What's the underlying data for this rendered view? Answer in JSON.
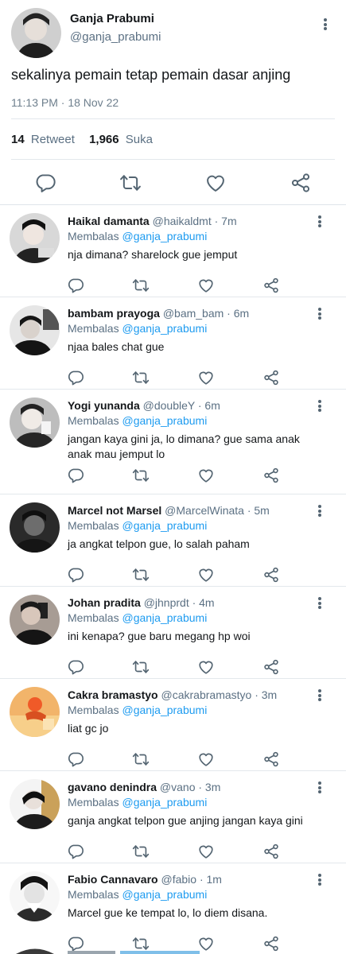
{
  "main_tweet": {
    "author_name": "Ganja Prabumi",
    "author_handle": "@ganja_prabumi",
    "text": "sekalinya pemain tetap pemain dasar anjing",
    "timestamp": "11:13 PM · 18 Nov 22",
    "retweets_count": "14",
    "retweets_label": "Retweet",
    "likes_count": "1,966",
    "likes_label": "Suka"
  },
  "replying_label": "Membalas",
  "replying_mention": "@ganja_prabumi",
  "replies": [
    {
      "name": "Haikal damanta",
      "meta": "@haikaldmt · 7m",
      "text": "nja dimana? sharelock gue jemput"
    },
    {
      "name": "bambam prayoga",
      "meta": "@bam_bam · 6m",
      "text": "njaa bales chat gue"
    },
    {
      "name": "Yogi yunanda",
      "meta": "@doubleY · 6m",
      "text": "jangan kaya gini ja, lo dimana? gue sama anak anak mau jemput lo"
    },
    {
      "name": "Marcel not Marsel",
      "meta": "@MarcelWinata · 5m",
      "text": "ja angkat telpon gue, lo salah paham"
    },
    {
      "name": "Johan pradita",
      "meta": "@jhnprdt · 4m",
      "text": "ini kenapa? gue baru megang hp woi"
    },
    {
      "name": "Cakra bramastyo",
      "meta": "@cakrabramastyo · 3m",
      "text": "liat gc jo"
    },
    {
      "name": "gavano denindra",
      "meta": "@vano · 3m",
      "text": "ganja angkat telpon gue anjing jangan kaya gini"
    },
    {
      "name": "Fabio Cannavaro",
      "meta": "@fabio · 1m",
      "text": "Marcel gue ke tempat lo, lo diem disana."
    }
  ],
  "icons": [
    "reply-icon",
    "retweet-icon",
    "like-icon",
    "share-icon",
    "more-options-icon"
  ],
  "colors": {
    "mention": "#1d9bf0",
    "secondary_text": "#5b7083",
    "icon": "#536471"
  }
}
